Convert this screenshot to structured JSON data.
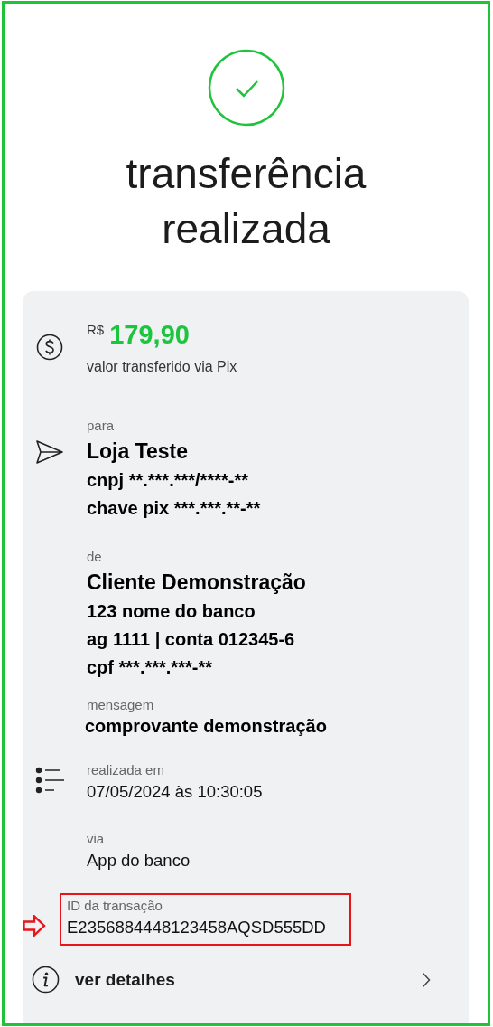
{
  "status": {
    "title": "transferência realizada"
  },
  "amount": {
    "currency": "R$",
    "value": "179,90",
    "caption": "valor transferido via Pix"
  },
  "recipient": {
    "label": "para",
    "name": "Loja Teste",
    "lines": [
      "cnpj **.***.***/****-**",
      "chave pix ***.***.**-**"
    ]
  },
  "payer": {
    "label": "de",
    "name": "Cliente Demonstração",
    "lines": [
      "123 nome do banco",
      "ag 1111 | conta 012345-6",
      "cpf ***.***.***-**"
    ]
  },
  "message": {
    "label": "mensagem",
    "text": "comprovante demonstração"
  },
  "details": [
    {
      "label": "realizada em",
      "value": "07/05/2024 às 10:30:05",
      "highlighted": false
    },
    {
      "label": "via",
      "value": "App do banco",
      "highlighted": false
    },
    {
      "label": "ID da transação",
      "value": "E2356884448123458AQSD555DD",
      "highlighted": true
    }
  ],
  "details_link": {
    "label": "ver detalhes"
  }
}
